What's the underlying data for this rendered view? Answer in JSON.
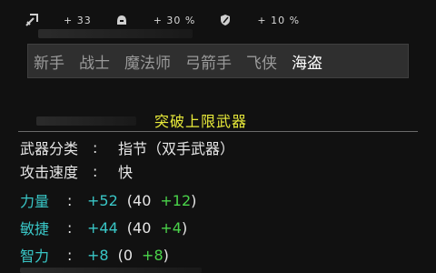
{
  "stats": [
    {
      "icon": "sword-icon",
      "value": "+ 33"
    },
    {
      "icon": "helmet-icon",
      "value": "+ 30 %"
    },
    {
      "icon": "shield-icon",
      "value": "+ 10 %"
    }
  ],
  "classes": [
    "新手",
    "战士",
    "魔法师",
    "弓箭手",
    "飞侠",
    "海盗"
  ],
  "active_class": "海盗",
  "item": {
    "name": "突破上限武器"
  },
  "attributes": {
    "weapon_type": {
      "label": "武器分类",
      "colon": ":",
      "value": "指节（双手武器）"
    },
    "attack_speed": {
      "label": "攻击速度",
      "colon": ":",
      "value": "快"
    }
  },
  "bonuses": [
    {
      "label": "力量",
      "colon": ":",
      "total": "+52",
      "open": "(",
      "base": "40",
      "bonus": "+12",
      "close": ")"
    },
    {
      "label": "敏捷",
      "colon": ":",
      "total": "+44",
      "open": "(",
      "base": "40",
      "bonus": "+4",
      "close": ")"
    },
    {
      "label": "智力",
      "colon": ":",
      "total": "+8",
      "open": "(",
      "base": "0",
      "bonus": "+8",
      "close": ")"
    }
  ],
  "colors": {
    "item_name": "#e8ea3a",
    "stat_label": "#39c6c6",
    "bonus": "#4ad44a",
    "active_class": "#ffffff",
    "inactive_class": "#9a9a9a"
  }
}
